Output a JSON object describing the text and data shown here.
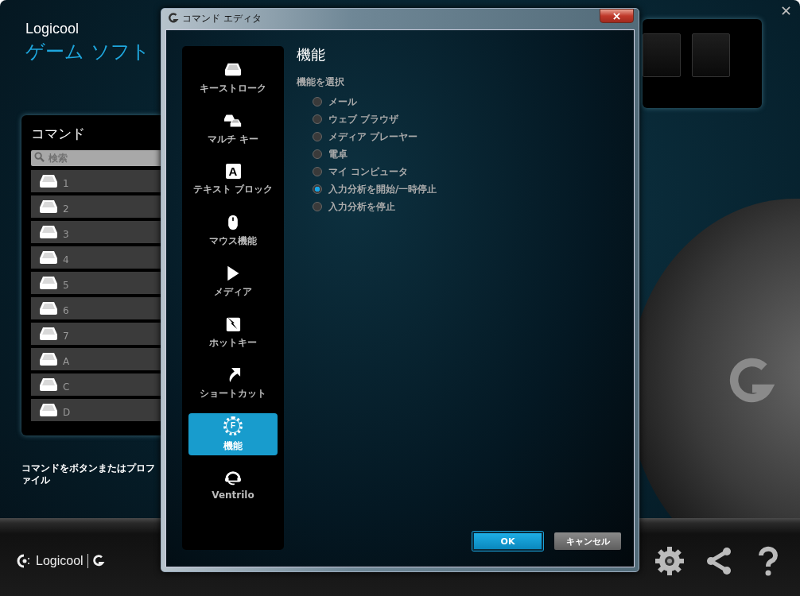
{
  "app": {
    "brand": "Logicool",
    "title": "ゲーム ソフト",
    "commands": {
      "title": "コマンド",
      "search": {
        "placeholder": "検索"
      },
      "items": [
        "1",
        "2",
        "3",
        "4",
        "5",
        "6",
        "7",
        "A",
        "C",
        "D"
      ]
    },
    "hint": "コマンドをボタンまたはプロファイル",
    "footer_logo": "Logicool"
  },
  "dialog": {
    "title": "コマンド エディタ",
    "categories": [
      {
        "label": "キーストローク",
        "kind": "key",
        "selected": false
      },
      {
        "label": "マルチ キー",
        "kind": "multikey",
        "selected": false
      },
      {
        "label": "テキスト ブロック",
        "kind": "text",
        "glyph": "A",
        "selected": false
      },
      {
        "label": "マウス機能",
        "kind": "mouse",
        "selected": false
      },
      {
        "label": "メディア",
        "kind": "media",
        "selected": false
      },
      {
        "label": "ホットキー",
        "kind": "hotkey",
        "selected": false
      },
      {
        "label": "ショートカット",
        "kind": "shortcut",
        "selected": false
      },
      {
        "label": "機能",
        "kind": "function",
        "glyph": "F",
        "selected": true
      },
      {
        "label": "Ventrilo",
        "kind": "headset",
        "selected": false
      }
    ],
    "heading": "機能",
    "group_label": "機能を選択",
    "options": [
      {
        "label": "メール",
        "selected": false
      },
      {
        "label": "ウェブ ブラウザ",
        "selected": false
      },
      {
        "label": "メディア プレーヤー",
        "selected": false
      },
      {
        "label": "電卓",
        "selected": false
      },
      {
        "label": "マイ コンピュータ",
        "selected": false
      },
      {
        "label": "入力分析を開始/一時停止",
        "selected": true
      },
      {
        "label": "入力分析を停止",
        "selected": false
      }
    ],
    "buttons": [
      {
        "label": "OK",
        "kind": "primary"
      },
      {
        "label": "キャンセル",
        "kind": "secondary"
      }
    ]
  }
}
